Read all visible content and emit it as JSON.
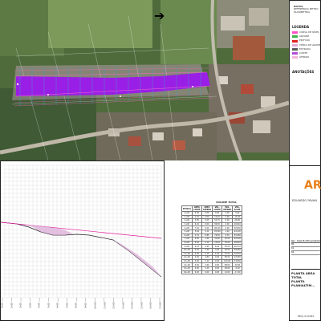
{
  "map": {
    "north_arrow": "➔"
  },
  "sidebar": {
    "legend_title": "LEGENDA",
    "legend_items": [
      {
        "label": "CURVA DE NÍVEL",
        "color": "#ff4fc6"
      },
      {
        "label": "ARVORE",
        "color": "#3cb44b"
      },
      {
        "label": "EDIFÍCIO",
        "color": "#e02020"
      },
      {
        "label": "CERCA DE ARAME",
        "color": "#e5a8d6"
      },
      {
        "label": "ESTRADA",
        "color": "#5a5a5a"
      },
      {
        "label": "CORTE",
        "color": "#b24ddb"
      },
      {
        "label": "ATERRO",
        "color": "#f4b6d8"
      }
    ],
    "notes_title": "ANOTAÇÕES",
    "header_notes": [
      "NOTAS",
      "REFERÊNCIA METRO",
      "PLANIMETRIA"
    ],
    "logo_text": "AR",
    "client_line": "EDUARDO PAVAN",
    "revision_header": [
      "Rev.",
      "Data",
      "Modificações",
      "Visto"
    ],
    "revisions": [
      "00",
      "01",
      "02"
    ],
    "drawing_title_1": "PLANTA ÁREA TOTAL",
    "drawing_title_2": "PLANTA PLANIALTIM...",
    "drawing_number": "PROJ. 01/2024"
  },
  "profile": {
    "station_labels": [
      "0+00",
      "1+00",
      "2+00",
      "3+00",
      "4+00",
      "5+00",
      "6+00",
      "7+00",
      "8+00",
      "9+00",
      "10+00",
      "11+00",
      "12+00",
      "13+00",
      "14+00",
      "15+00",
      "16+00",
      "17+00"
    ]
  },
  "volume_table": {
    "title": "VOLUME TOTAL",
    "headers": [
      "ESTACA",
      "ÁREA CORTE",
      "ÁREA ATERRO",
      "VOL. CORTE",
      "VOL. ATERRO",
      "VOL. ACUM."
    ],
    "rows": [
      [
        "0+00",
        "0.00",
        "0.00",
        "0.00",
        "0.00",
        "0.00"
      ],
      [
        "1+00",
        "1.42",
        "0.00",
        "14.20",
        "0.00",
        "14.20"
      ],
      [
        "2+00",
        "3.85",
        "0.00",
        "52.70",
        "0.00",
        "66.90"
      ],
      [
        "3+00",
        "6.10",
        "0.00",
        "99.50",
        "0.00",
        "166.40"
      ],
      [
        "4+00",
        "7.92",
        "0.00",
        "140.20",
        "0.00",
        "306.60"
      ],
      [
        "5+00",
        "5.64",
        "0.12",
        "135.60",
        "1.20",
        "441.00"
      ],
      [
        "6+00",
        "2.31",
        "0.85",
        "79.50",
        "9.70",
        "510.80"
      ],
      [
        "7+00",
        "0.95",
        "1.40",
        "32.60",
        "22.50",
        "520.90"
      ],
      [
        "8+00",
        "0.40",
        "2.10",
        "13.50",
        "35.00",
        "499.40"
      ],
      [
        "9+00",
        "0.22",
        "2.95",
        "6.20",
        "50.50",
        "455.10"
      ],
      [
        "10+00",
        "0.10",
        "3.40",
        "3.20",
        "63.50",
        "394.80"
      ],
      [
        "11+00",
        "0.00",
        "4.15",
        "1.00",
        "75.50",
        "320.30"
      ],
      [
        "12+00",
        "0.00",
        "4.80",
        "0.00",
        "89.50",
        "230.80"
      ],
      [
        "13+00",
        "0.00",
        "5.20",
        "0.00",
        "100.00",
        "130.80"
      ],
      [
        "14+00",
        "0.00",
        "3.60",
        "0.00",
        "88.00",
        "42.80"
      ],
      [
        "15+00",
        "0.00",
        "1.20",
        "0.00",
        "48.00",
        "-5.20"
      ],
      [
        "16+00",
        "0.00",
        "0.00",
        "0.00",
        "12.00",
        "-17.20"
      ]
    ]
  }
}
